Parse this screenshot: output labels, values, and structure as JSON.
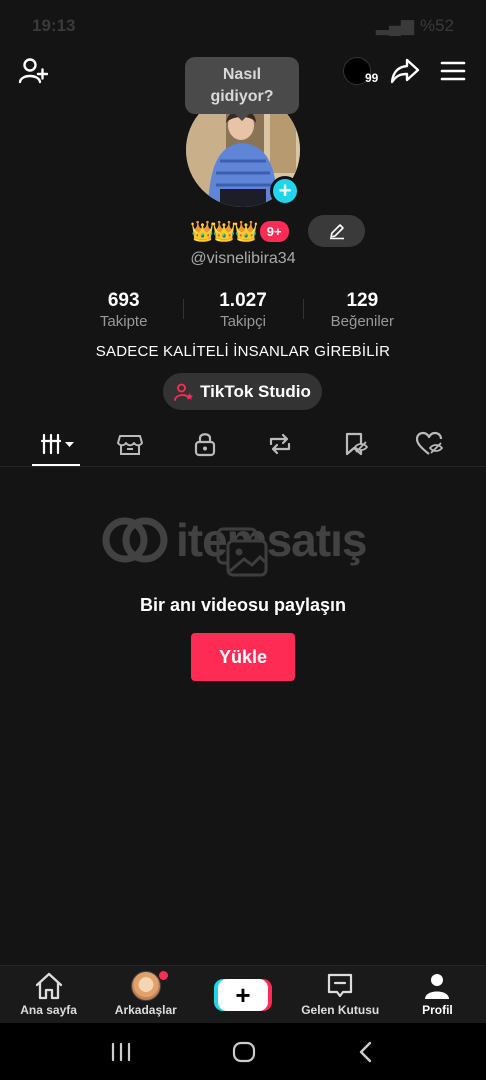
{
  "status_bar": {
    "time": "19:13",
    "battery": "%52"
  },
  "top_bar": {
    "add_user_icon": "add-user-icon",
    "coin_count": "99",
    "share_icon": "share-icon",
    "menu_icon": "hamburger-menu-icon"
  },
  "tooltip": {
    "text_line1": "Nasıl",
    "text_line2": "gidiyor?"
  },
  "profile": {
    "avatar_plus": "+",
    "crowns": "👑👑👑",
    "level_badge": "9+",
    "username": "@visnelibira34",
    "bio": "SADECE KALİTELİ İNSANLAR GİREBİLİR",
    "studio_button": "TikTok Studio"
  },
  "stats": [
    {
      "value": "693",
      "label": "Takipte"
    },
    {
      "value": "1.027",
      "label": "Takipçi"
    },
    {
      "value": "129",
      "label": "Beğeniler"
    }
  ],
  "tabs": [
    {
      "icon": "videos-grid-icon",
      "active": true
    },
    {
      "icon": "shop-icon",
      "active": false
    },
    {
      "icon": "lock-icon",
      "active": false
    },
    {
      "icon": "repost-icon",
      "active": false
    },
    {
      "icon": "bookmark-hidden-icon",
      "active": false
    },
    {
      "icon": "liked-hidden-icon",
      "active": false
    }
  ],
  "watermark": {
    "text": "itemsatış"
  },
  "empty_state": {
    "title": "Bir anı videosu paylaşın",
    "upload_button": "Yükle"
  },
  "bottom_nav": {
    "home": "Ana sayfa",
    "friends": "Arkadaşlar",
    "create": "+",
    "inbox": "Gelen Kutusu",
    "profile": "Profil"
  },
  "colors": {
    "background": "#141414",
    "accent_red": "#fe2c55",
    "accent_cyan": "#20d5ec"
  }
}
